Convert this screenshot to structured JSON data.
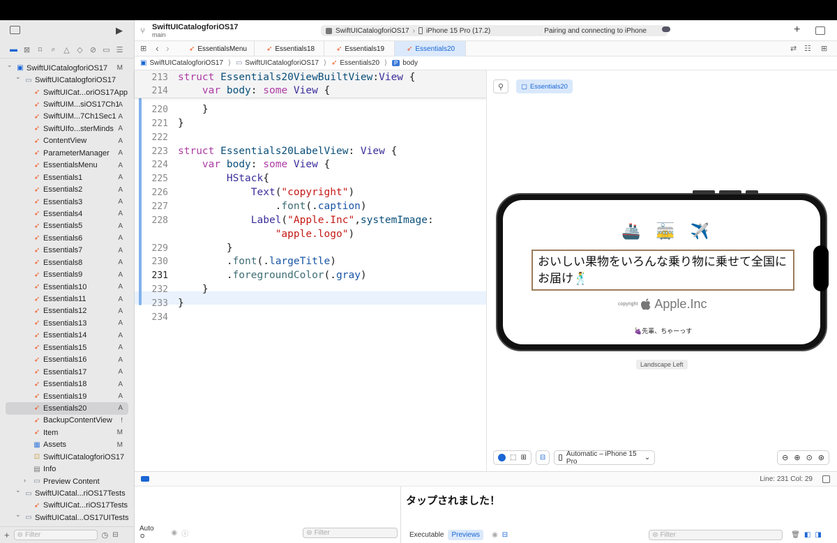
{
  "toolbar": {
    "project_title": "SwiftUICatalogforiOS17",
    "branch": "main",
    "scheme": "SwiftUICatalogforiOS17",
    "device": "iPhone 15 Pro (17.2)",
    "status": "Pairing and connecting to iPhone",
    "add_label": "+"
  },
  "tabs": [
    "EssentialsMenu",
    "Essentials18",
    "Essentials19",
    "Essentials20"
  ],
  "jumpbar": [
    "SwiftUICatalogforiOS17",
    "SwiftUICatalogforiOS17",
    "Essentials20",
    "body"
  ],
  "sidebar": {
    "items": [
      {
        "label": "SwiftUICatalogforiOS17",
        "status": "M",
        "indent": 0,
        "kind": "project",
        "disclosure": "v"
      },
      {
        "label": "SwiftUICatalogforiOS17",
        "status": "",
        "indent": 1,
        "kind": "folder",
        "disclosure": "v"
      },
      {
        "label": "SwiftUICat...oriOS17App",
        "status": "",
        "indent": 2,
        "kind": "swift"
      },
      {
        "label": "SwiftUIM...siOS17Ch1",
        "status": "A",
        "indent": 2,
        "kind": "swift"
      },
      {
        "label": "SwiftUIM...7Ch1Sec1",
        "status": "A",
        "indent": 2,
        "kind": "swift"
      },
      {
        "label": "SwiftUIfo...sterMinds",
        "status": "A",
        "indent": 2,
        "kind": "swift"
      },
      {
        "label": "ContentView",
        "status": "A",
        "indent": 2,
        "kind": "swift"
      },
      {
        "label": "ParameterManager",
        "status": "A",
        "indent": 2,
        "kind": "swift"
      },
      {
        "label": "EssentialsMenu",
        "status": "A",
        "indent": 2,
        "kind": "swift"
      },
      {
        "label": "Essentials1",
        "status": "A",
        "indent": 2,
        "kind": "swift"
      },
      {
        "label": "Essentials2",
        "status": "A",
        "indent": 2,
        "kind": "swift"
      },
      {
        "label": "Essentials3",
        "status": "A",
        "indent": 2,
        "kind": "swift"
      },
      {
        "label": "Essentials4",
        "status": "A",
        "indent": 2,
        "kind": "swift"
      },
      {
        "label": "Essentials5",
        "status": "A",
        "indent": 2,
        "kind": "swift"
      },
      {
        "label": "Essentials6",
        "status": "A",
        "indent": 2,
        "kind": "swift"
      },
      {
        "label": "Essentials7",
        "status": "A",
        "indent": 2,
        "kind": "swift"
      },
      {
        "label": "Essentials8",
        "status": "A",
        "indent": 2,
        "kind": "swift"
      },
      {
        "label": "Essentials9",
        "status": "A",
        "indent": 2,
        "kind": "swift"
      },
      {
        "label": "Essentials10",
        "status": "A",
        "indent": 2,
        "kind": "swift"
      },
      {
        "label": "Essentials11",
        "status": "A",
        "indent": 2,
        "kind": "swift"
      },
      {
        "label": "Essentials12",
        "status": "A",
        "indent": 2,
        "kind": "swift"
      },
      {
        "label": "Essentials13",
        "status": "A",
        "indent": 2,
        "kind": "swift"
      },
      {
        "label": "Essentials14",
        "status": "A",
        "indent": 2,
        "kind": "swift"
      },
      {
        "label": "Essentials15",
        "status": "A",
        "indent": 2,
        "kind": "swift"
      },
      {
        "label": "Essentials16",
        "status": "A",
        "indent": 2,
        "kind": "swift"
      },
      {
        "label": "Essentials17",
        "status": "A",
        "indent": 2,
        "kind": "swift"
      },
      {
        "label": "Essentials18",
        "status": "A",
        "indent": 2,
        "kind": "swift"
      },
      {
        "label": "Essentials19",
        "status": "A",
        "indent": 2,
        "kind": "swift"
      },
      {
        "label": "Essentials20",
        "status": "A",
        "indent": 2,
        "kind": "swift",
        "selected": true
      },
      {
        "label": "BackupContentView",
        "status": "!",
        "indent": 2,
        "kind": "swift"
      },
      {
        "label": "Item",
        "status": "M",
        "indent": 2,
        "kind": "swift"
      },
      {
        "label": "Assets",
        "status": "M",
        "indent": 2,
        "kind": "assets"
      },
      {
        "label": "SwiftUICatalogforiOS17",
        "status": "",
        "indent": 2,
        "kind": "entitlements"
      },
      {
        "label": "Info",
        "status": "",
        "indent": 2,
        "kind": "plist"
      },
      {
        "label": "Preview Content",
        "status": "",
        "indent": 2,
        "kind": "folder",
        "disclosure": ">"
      },
      {
        "label": "SwiftUICatal...riOS17Tests",
        "status": "",
        "indent": 1,
        "kind": "folder",
        "disclosure": "v"
      },
      {
        "label": "SwiftUICat...riOS17Tests",
        "status": "",
        "indent": 2,
        "kind": "swift"
      },
      {
        "label": "SwiftUICatal...OS17UITests",
        "status": "",
        "indent": 1,
        "kind": "folder",
        "disclosure": "v"
      }
    ],
    "filter_placeholder": "Filter"
  },
  "code": {
    "sticky": [
      {
        "n": "213",
        "text": "struct Essentials20ViewBuiltView:View {"
      },
      {
        "n": "214",
        "text": "    var body: some View {"
      }
    ],
    "lines": [
      {
        "n": "220",
        "text": "    }"
      },
      {
        "n": "221",
        "text": "}"
      },
      {
        "n": "222",
        "text": ""
      },
      {
        "n": "223",
        "text": "struct Essentials20LabelView: View {"
      },
      {
        "n": "224",
        "text": "    var body: some View {"
      },
      {
        "n": "225",
        "text": "        HStack{"
      },
      {
        "n": "226",
        "text": "            Text(\"copyright\")"
      },
      {
        "n": "227",
        "text": "                .font(.caption)"
      },
      {
        "n": "228",
        "text": "            Label(\"Apple.Inc\",systemImage:"
      },
      {
        "n": "",
        "text": "                \"apple.logo\")"
      },
      {
        "n": "229",
        "text": "        }"
      },
      {
        "n": "230",
        "text": "        .font(.largeTitle)"
      },
      {
        "n": "231",
        "text": "        .foregroundColor(.gray)"
      },
      {
        "n": "232",
        "text": "    }"
      },
      {
        "n": "233",
        "text": "}"
      },
      {
        "n": "234",
        "text": ""
      }
    ],
    "current_line": "231"
  },
  "preview": {
    "chip_label": "Essentials20",
    "emojis": [
      "🚢",
      "🚋",
      "✈️"
    ],
    "message": "おいしい果物をいろんな乗り物に乗せて全国にお届け🕺",
    "copyright": "copyright",
    "apple_label": "Apple.Inc",
    "senpai": "🍇先輩、ちゃーっす",
    "orientation": "Landscape Left",
    "device_menu": "Automatic – iPhone 15 Pro"
  },
  "debug": {
    "line_col": "Line: 231  Col: 29",
    "console_text": "タップされました！",
    "auto_label": "Auto ≎",
    "filter_placeholder": "Filter",
    "executable": "Executable",
    "previews": "Previews"
  },
  "colors": {
    "accent": "#1a66d4",
    "swift": "#f0541a",
    "keyword": "#ad3da4",
    "border_brown": "#9c7d5a"
  }
}
